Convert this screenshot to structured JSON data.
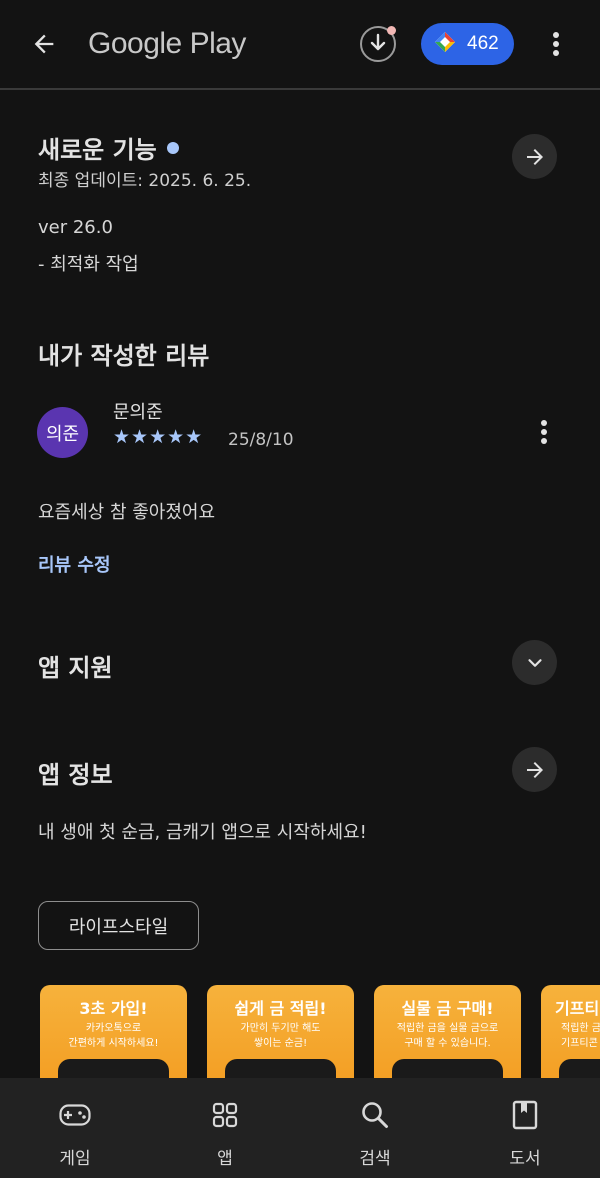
{
  "topbar": {
    "brand": "Google Play",
    "points": "462"
  },
  "whats_new": {
    "title": "새로운 기능",
    "updated": "최종 업데이트: 2025. 6. 25.",
    "version": "ver 26.0",
    "note": "- 최적화 작업"
  },
  "my_review": {
    "title": "내가 작성한 리뷰",
    "avatar_text": "의준",
    "author": "문의준",
    "stars": "★★★★★",
    "rating": 5,
    "date": "25/8/10",
    "body": "요즘세상 참 좋아졌어요",
    "edit_label": "리뷰 수정"
  },
  "app_support": {
    "title": "앱 지원"
  },
  "app_info": {
    "title": "앱 정보",
    "description": "내 생애 첫 순금, 금캐기 앱으로 시작하세요!",
    "chip": "라이프스타일"
  },
  "screenshots": [
    {
      "title": "3초 가입!",
      "subtitle": "카카오톡으로\n간편하게 시작하세요!"
    },
    {
      "title": "쉽게 금 적립!",
      "subtitle": "가만히 두기만 해도\n쌓이는 순금!"
    },
    {
      "title": "실물 금 구매!",
      "subtitle": "적립한 금을 실물 금으로\n구매 할 수 있습니다."
    },
    {
      "title": "기프티",
      "subtitle": "적립한 금\n기프티콘"
    }
  ],
  "bottom_nav": [
    {
      "label": "게임",
      "icon": "gamepad-icon"
    },
    {
      "label": "앱",
      "icon": "apps-grid-icon"
    },
    {
      "label": "검색",
      "icon": "search-icon"
    },
    {
      "label": "도서",
      "icon": "book-icon"
    }
  ],
  "colors": {
    "background": "#131313",
    "accent_blue": "#a8c7fa",
    "points_pill": "#2d64e6",
    "avatar": "#5a35b0",
    "screenshot_orange": "#f5a72c"
  }
}
